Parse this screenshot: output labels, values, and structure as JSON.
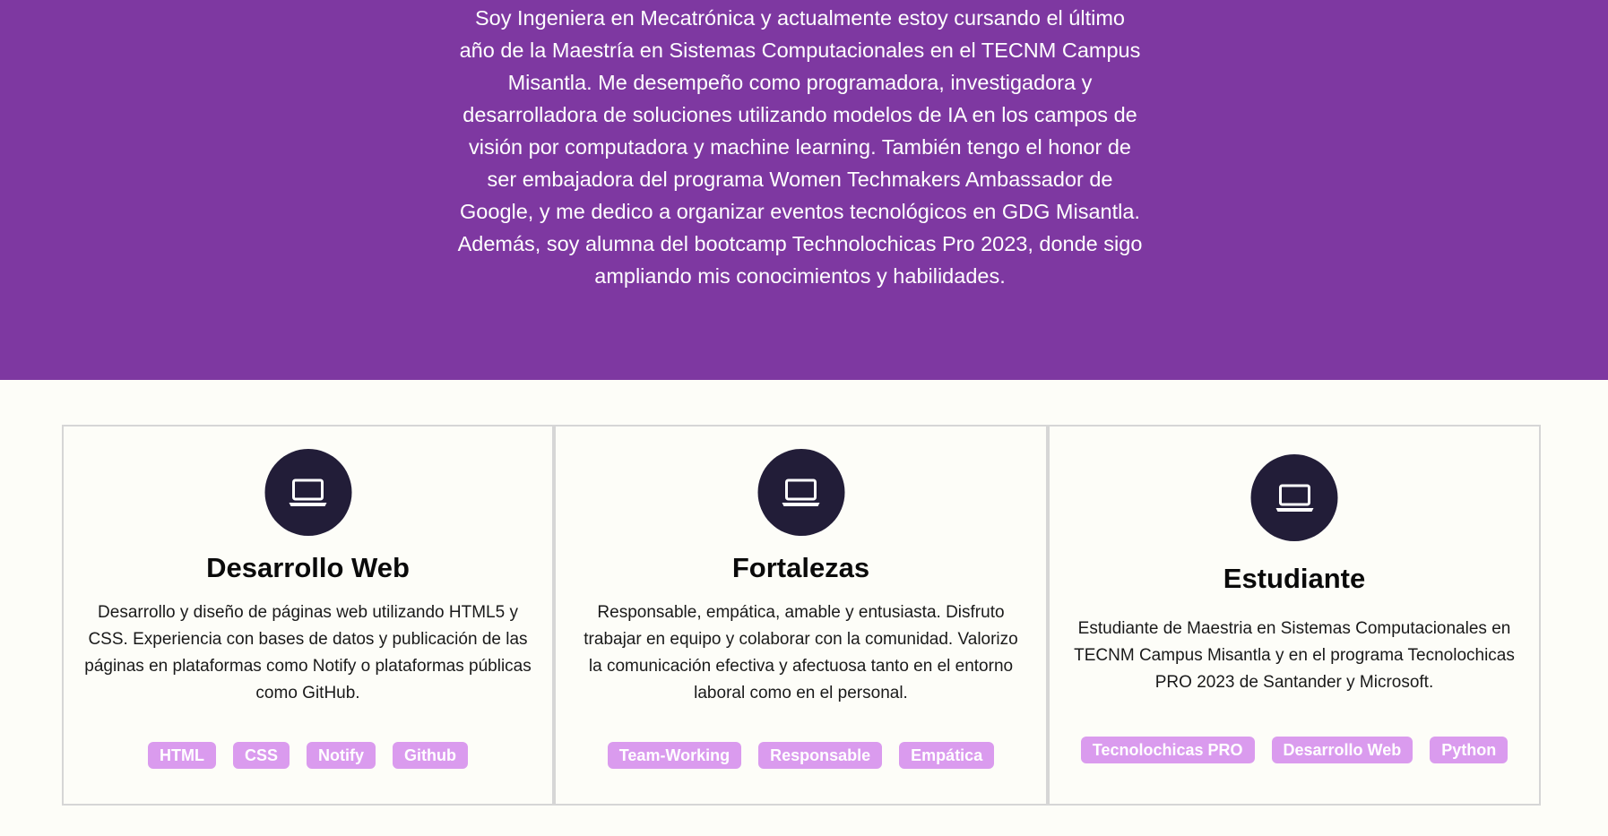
{
  "hero": {
    "background_color": "#7e38a1",
    "text": "Soy Ingeniera en Mecatrónica y actualmente estoy cursando el último año de la Maestría en Sistemas Computacionales en el TECNM Campus Misantla. Me desempeño como programadora, investigadora y desarrolladora de soluciones utilizando modelos de IA en los campos de visión por computadora y machine learning. También tengo el honor de ser embajadora del programa Women Techmakers Ambassador de Google, y me dedico a organizar eventos tecnológicos en GDG Misantla. Además, soy alumna del bootcamp Technolochicas Pro 2023, donde sigo ampliando mis conocimientos y habilidades."
  },
  "cards": [
    {
      "icon": "laptop-icon",
      "title": "Desarrollo Web",
      "description": "Desarrollo y diseño de páginas web utilizando HTML5 y CSS. Experiencia con bases de datos y publicación de las páginas en plataformas como Notify o plataformas públicas como GitHub.",
      "tags": [
        "HTML",
        "CSS",
        "Notify",
        "Github"
      ]
    },
    {
      "icon": "laptop-icon",
      "title": "Fortalezas",
      "description": "Responsable, empática, amable y entusiasta. Disfruto trabajar en equipo y colaborar con la comunidad. Valorizo la comunicación efectiva y afectuosa tanto en el entorno laboral como en el personal.",
      "tags": [
        "Team-Working",
        "Responsable",
        "Empática"
      ]
    },
    {
      "icon": "laptop-icon",
      "title": "Estudiante",
      "description": "Estudiante de Maestria en Sistemas Computacionales en TECNM Campus Misantla y en el programa Tecnolochicas PRO 2023 de Santander y Microsoft.",
      "tags": [
        "Tecnolochicas PRO",
        "Desarrollo Web",
        "Python"
      ]
    }
  ],
  "colors": {
    "icon_circle": "#221d38",
    "tag_background": "#da9bee",
    "page_background": "#fdfdf8"
  }
}
